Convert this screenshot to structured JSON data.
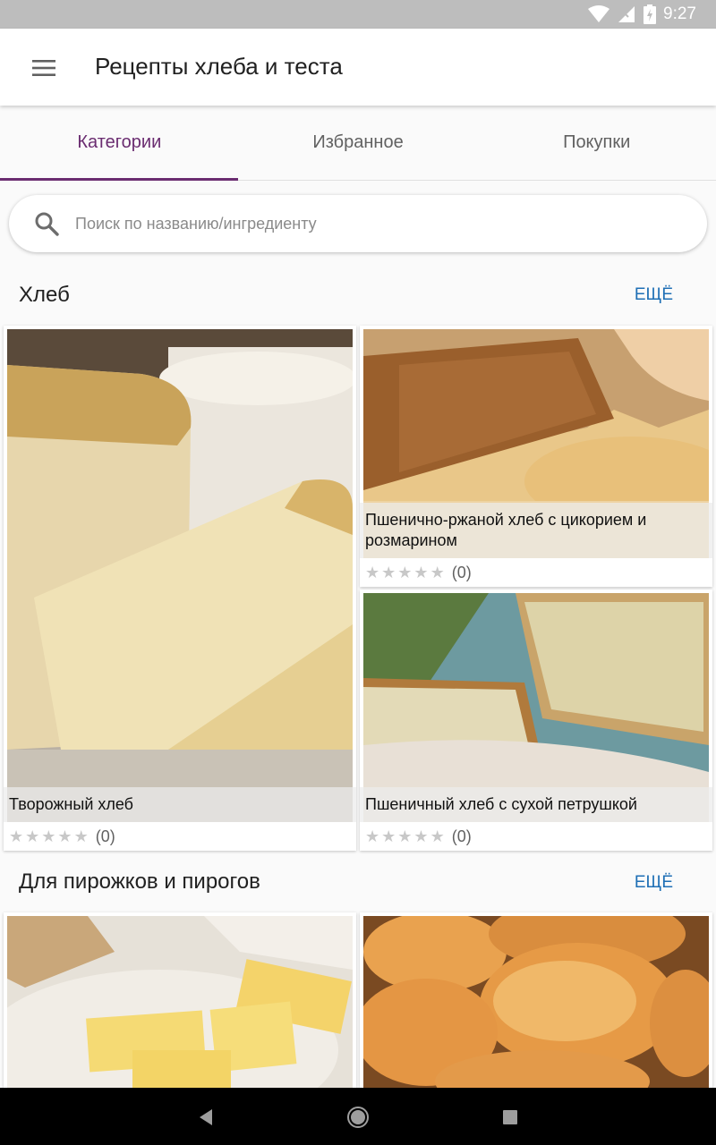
{
  "status": {
    "time": "9:27"
  },
  "app": {
    "title": "Рецепты хлеба и теста"
  },
  "tabs": [
    {
      "label": "Категории"
    },
    {
      "label": "Избранное"
    },
    {
      "label": "Покупки"
    }
  ],
  "search": {
    "placeholder": "Поиск по названию/ингредиенту"
  },
  "sections": [
    {
      "title": "Хлеб",
      "more": "ЕЩЁ",
      "cards": [
        {
          "title": "Творожный хлеб",
          "rating": 0,
          "count": "(0)"
        },
        {
          "title": "Пшенично-ржаной хлеб с цикорием и розмарином",
          "rating": 0,
          "count": "(0)"
        },
        {
          "title": "Пшеничный хлеб с сухой петрушкой",
          "rating": 0,
          "count": "(0)"
        }
      ]
    },
    {
      "title": "Для пирожков и пирогов",
      "more": "ЕЩЁ"
    }
  ],
  "icons": {
    "menu": "menu-icon",
    "search": "search-icon",
    "wifi": "wifi-icon",
    "signal": "signal-icon",
    "battery": "battery-icon",
    "back": "back-icon",
    "home": "home-icon",
    "recents": "recents-icon"
  },
  "colors": {
    "accent": "#6a2c70",
    "link": "#1e6fb5",
    "status_bar": "#bdbdbd"
  }
}
